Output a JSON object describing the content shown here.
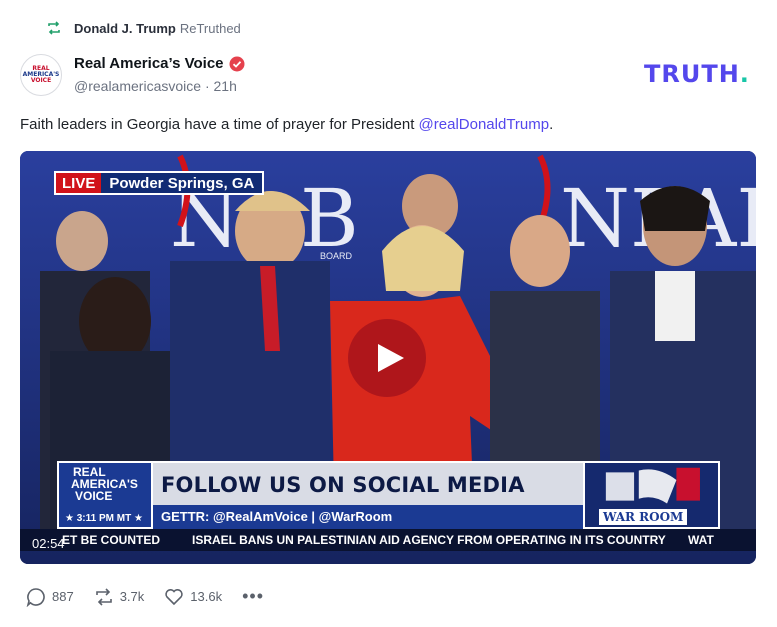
{
  "retruth": {
    "user": "Donald J. Trump",
    "action": "ReTruthed",
    "icon": "retruth-icon"
  },
  "author": {
    "name": "Real America’s Voice",
    "handle": "@realamericasvoice",
    "separator": "·",
    "age": "21h",
    "avatar_logo": [
      "REAL",
      "AMERICA'S",
      "VOICE"
    ]
  },
  "brand": {
    "text": "TRUTH",
    "dot": "."
  },
  "post": {
    "text": "Faith leaders in Georgia have a time of prayer for President ",
    "mention": "@realDonaldTrump",
    "end": "."
  },
  "video": {
    "live_label": "LIVE",
    "location": "Powder Springs, GA",
    "backdrop_text": "BOARD",
    "lower_third_headline": "FOLLOW US ON SOCIAL MEDIA",
    "lower_third_sub": "GETTR: @RealAmVoice  |  @WarRoom",
    "channel_logo": {
      "l1": "REAL",
      "l2": "AMERICA'S",
      "l3": "VOICE",
      "time": "★ 3:11 PM MT ★"
    },
    "warroom": "WAR ROOM",
    "ticker_left": "ET BE COUNTED",
    "ticker_main": "ISRAEL BANS UN PALESTINIAN AID AGENCY FROM OPERATING IN ITS COUNTRY",
    "ticker_right": "WAT",
    "duration": "02:54"
  },
  "actions": {
    "replies": "887",
    "retruths": "3.7k",
    "likes": "13.6k",
    "more": "•••"
  },
  "colors": {
    "brand": "#5447ec",
    "teal": "#18c6a7",
    "live_red": "#d1121a",
    "verified": "#e5414d"
  }
}
